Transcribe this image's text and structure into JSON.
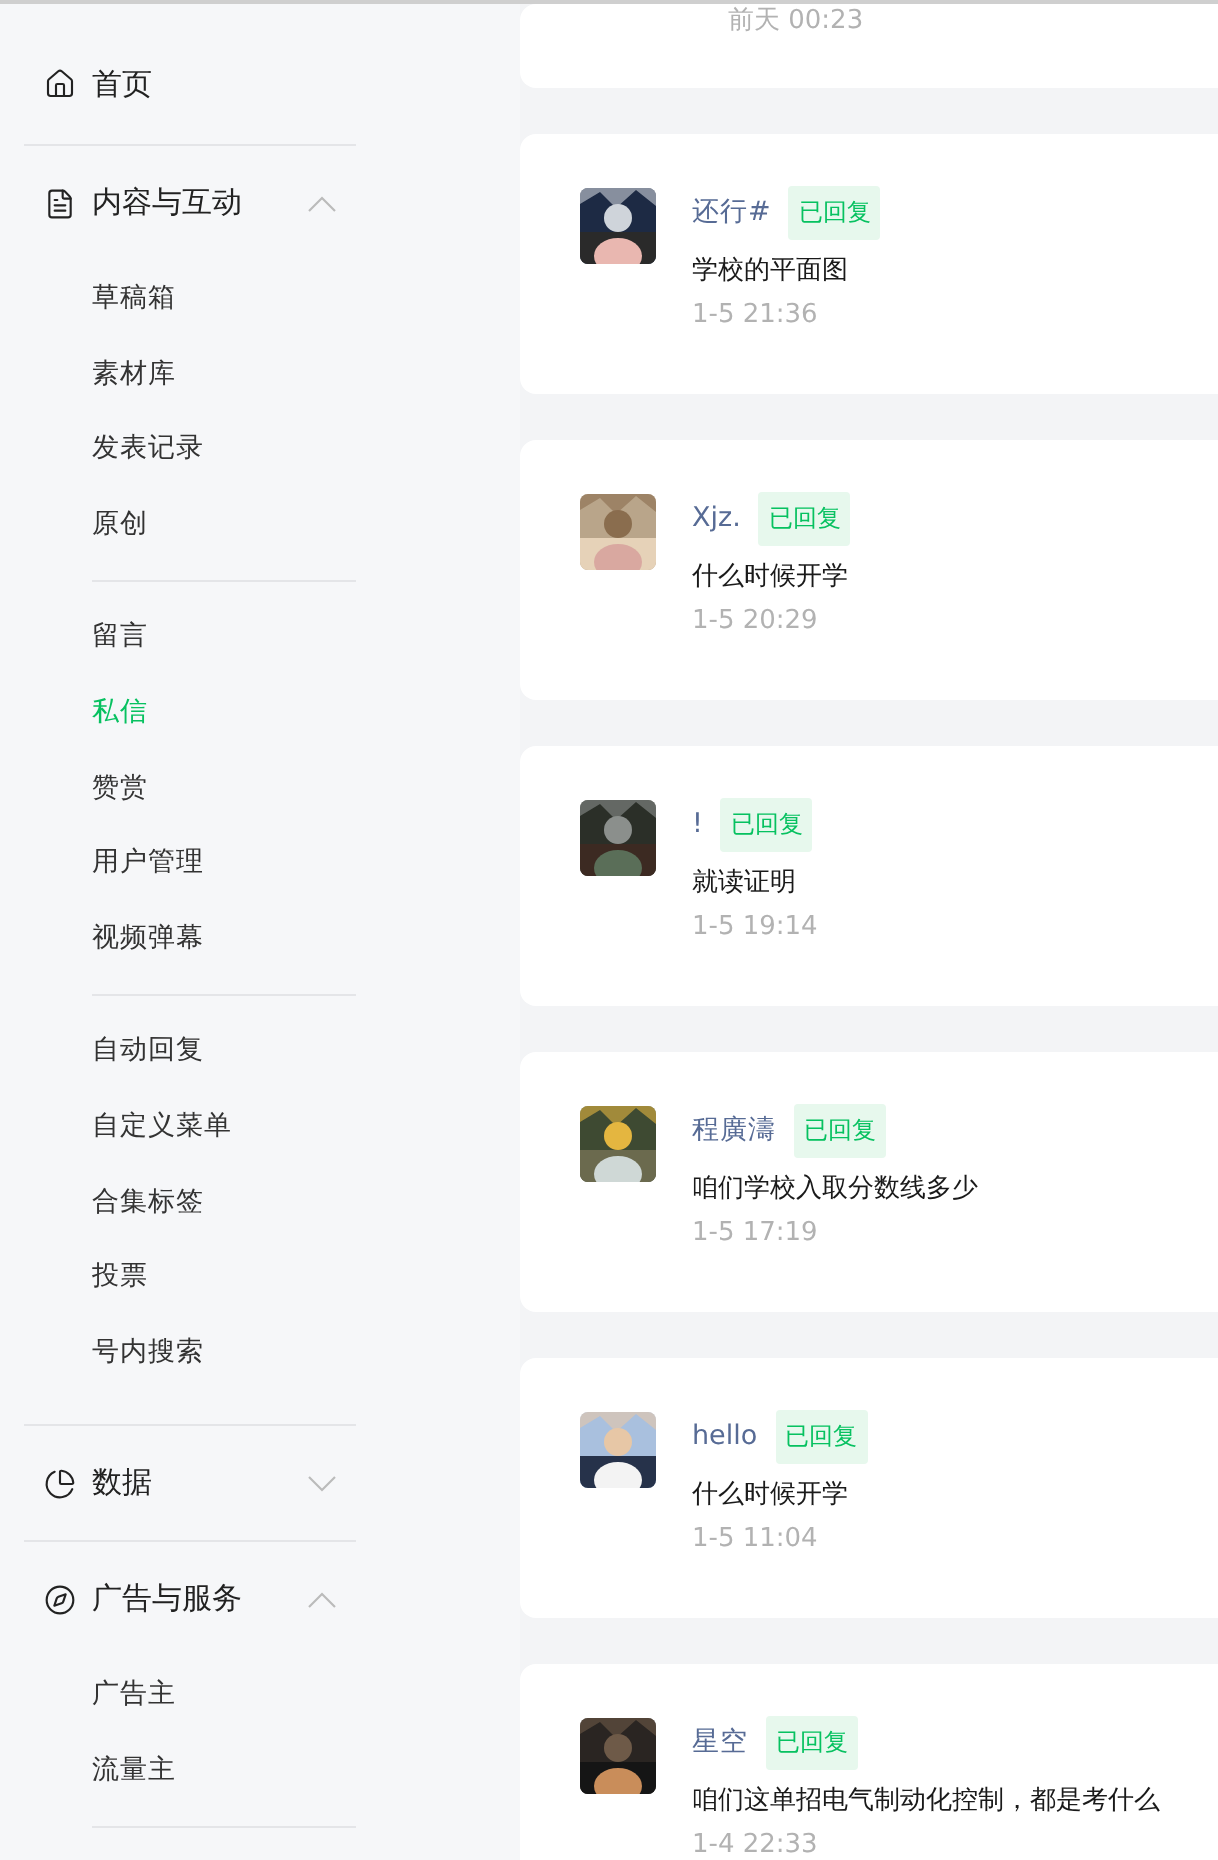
{
  "sidebar": {
    "sections": [
      {
        "kind": "link",
        "label": "首页"
      },
      {
        "kind": "group",
        "label": "内容与互动",
        "expanded": true,
        "groups": [
          [
            {
              "label": "草稿箱",
              "selected": false
            },
            {
              "label": "素材库",
              "selected": false
            },
            {
              "label": "发表记录",
              "selected": false
            },
            {
              "label": "原创",
              "selected": false
            }
          ],
          [
            {
              "label": "留言",
              "selected": false
            },
            {
              "label": "私信",
              "selected": true
            },
            {
              "label": "赞赏",
              "selected": false
            },
            {
              "label": "用户管理",
              "selected": false
            },
            {
              "label": "视频弹幕",
              "selected": false
            }
          ],
          [
            {
              "label": "自动回复",
              "selected": false
            },
            {
              "label": "自定义菜单",
              "selected": false
            },
            {
              "label": "合集标签",
              "selected": false
            },
            {
              "label": "投票",
              "selected": false
            },
            {
              "label": "号内搜索",
              "selected": false
            }
          ]
        ]
      },
      {
        "kind": "group",
        "label": "数据",
        "expanded": false
      },
      {
        "kind": "group",
        "label": "广告与服务",
        "expanded": true,
        "groups": [
          [
            {
              "label": "广告主",
              "selected": false
            },
            {
              "label": "流量主",
              "selected": false
            }
          ]
        ]
      }
    ]
  },
  "messages": {
    "partial_time": "前天 00:23",
    "items": [
      {
        "name": "还行#",
        "status": "已回复",
        "text": "学校的平面图",
        "time": "1-5 21:36"
      },
      {
        "name": "Xjz.",
        "status": "已回复",
        "text": "什么时候开学",
        "time": "1-5 20:29"
      },
      {
        "name": "!",
        "status": "已回复",
        "text": "就读证明",
        "time": "1-5 19:14"
      },
      {
        "name": "程廣濤",
        "status": "已回复",
        "text": "咱们学校入取分数线多少",
        "time": "1-5 17:19"
      },
      {
        "name": "hello",
        "status": "已回复",
        "text": "什么时候开学",
        "time": "1-5 11:04"
      },
      {
        "name": "星空",
        "status": "已回复",
        "text": "咱们这单招电气制动化控制，都是考什么",
        "time": "1-4 22:33"
      }
    ]
  }
}
